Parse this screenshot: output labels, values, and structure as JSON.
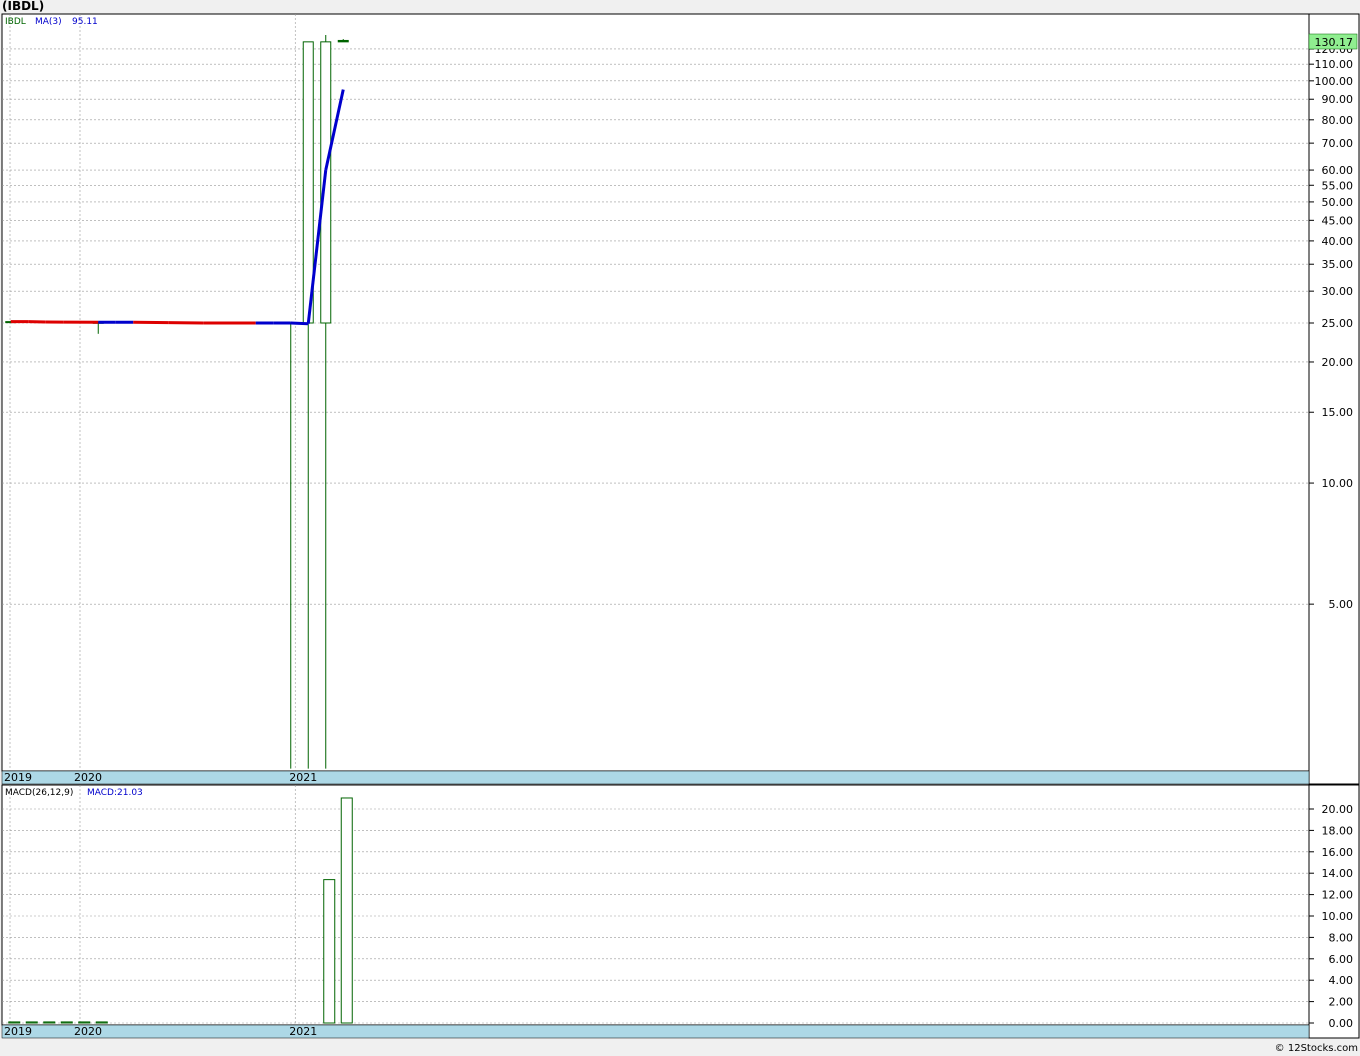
{
  "title": "(IBDL)",
  "footer": "© 12Stocks.com",
  "colors": {
    "up": "#006400",
    "down": "#000000",
    "ma_line": "#0000cc",
    "ma_down": "#dd0000",
    "axis_band": "#add8e6",
    "last_price_bg": "#90ee90",
    "grid": "#999999"
  },
  "chart_data": [
    {
      "type": "candlestick",
      "panel": "price",
      "legend": {
        "symbol": "IBDL",
        "ma_label": "MA(3)",
        "ma_value": "95.11"
      },
      "scale": "log",
      "ylim": [
        1.95,
        130
      ],
      "y_ticks": [
        5,
        10,
        15,
        20,
        25,
        30,
        35,
        40,
        45,
        50,
        55,
        60,
        70,
        80,
        90,
        100,
        110,
        120
      ],
      "y_tick_labels": [
        "5.00",
        "10.00",
        "15.00",
        "20.00",
        "25.00",
        "30.00",
        "35.00",
        "40.00",
        "45.00",
        "50.00",
        "55.00",
        "60.00",
        "70.00",
        "80.00",
        "90.00",
        "100.00",
        "110.00",
        "120.00"
      ],
      "last_price": "130.17",
      "x_labels": [
        {
          "text": "2019",
          "index": 0
        },
        {
          "text": "2020",
          "index": 4
        },
        {
          "text": "2021",
          "index": 16.3
        }
      ],
      "x_count": 72,
      "candles": [
        {
          "i": 0.5,
          "open": 25.2,
          "close": 25.2,
          "high": 25.3,
          "low": 25.1
        },
        {
          "i": 5.5,
          "open": 25.1,
          "close": 25.1,
          "high": 25.2,
          "low": 23.5
        },
        {
          "i": 16.5,
          "open": 25.0,
          "close": 25.0,
          "high": 25.0,
          "low": 1.95
        },
        {
          "i": 17.5,
          "open": 25.0,
          "close": 125.0,
          "high": 125.0,
          "low": 1.95
        },
        {
          "i": 18.5,
          "open": 25.0,
          "close": 125.0,
          "high": 130.0,
          "low": 1.95
        },
        {
          "i": 19.5,
          "open": 125.0,
          "close": 126.0,
          "high": 127.0,
          "low": 125.0
        }
      ],
      "ma": {
        "name": "MA(3)",
        "points": [
          {
            "i": 0.5,
            "v": 25.2,
            "dir": "up"
          },
          {
            "i": 1.5,
            "v": 25.2,
            "dir": "down"
          },
          {
            "i": 2.5,
            "v": 25.15,
            "dir": "down"
          },
          {
            "i": 3.5,
            "v": 25.12,
            "dir": "down"
          },
          {
            "i": 5.5,
            "v": 25.1,
            "dir": "down"
          },
          {
            "i": 6.5,
            "v": 25.1,
            "dir": "up"
          },
          {
            "i": 7.5,
            "v": 25.1,
            "dir": "up"
          },
          {
            "i": 9.5,
            "v": 25.05,
            "dir": "down"
          },
          {
            "i": 11.5,
            "v": 25.0,
            "dir": "down"
          },
          {
            "i": 14.5,
            "v": 25.0,
            "dir": "down"
          },
          {
            "i": 15.5,
            "v": 25.0,
            "dir": "up"
          },
          {
            "i": 16.5,
            "v": 25.0,
            "dir": "up"
          },
          {
            "i": 17.5,
            "v": 24.9,
            "dir": "up"
          },
          {
            "i": 18.5,
            "v": 60.0,
            "dir": "up"
          },
          {
            "i": 19.5,
            "v": 95.11,
            "dir": "up"
          }
        ]
      }
    },
    {
      "type": "bar",
      "panel": "macd",
      "legend": {
        "label": "MACD(26,12,9)",
        "value_label": "MACD:21.03"
      },
      "ylim": [
        0,
        21.5
      ],
      "y_ticks": [
        0,
        2,
        4,
        6,
        8,
        10,
        12,
        14,
        16,
        18,
        20
      ],
      "y_tick_labels": [
        "0.00",
        "2.00",
        "4.00",
        "6.00",
        "8.00",
        "10.00",
        "12.00",
        "14.00",
        "16.00",
        "18.00",
        "20.00"
      ],
      "x_labels": [
        {
          "text": "2019",
          "index": 0
        },
        {
          "text": "2020",
          "index": 4
        },
        {
          "text": "2021",
          "index": 16.3
        }
      ],
      "bars": [
        {
          "i": 0.5,
          "v": 0.1
        },
        {
          "i": 1.5,
          "v": 0.1
        },
        {
          "i": 2.5,
          "v": 0.1
        },
        {
          "i": 3.5,
          "v": 0.1
        },
        {
          "i": 4.5,
          "v": 0.1
        },
        {
          "i": 5.5,
          "v": 0.1
        },
        {
          "i": 18.5,
          "v": 13.4
        },
        {
          "i": 19.5,
          "v": 21.03
        }
      ]
    }
  ]
}
